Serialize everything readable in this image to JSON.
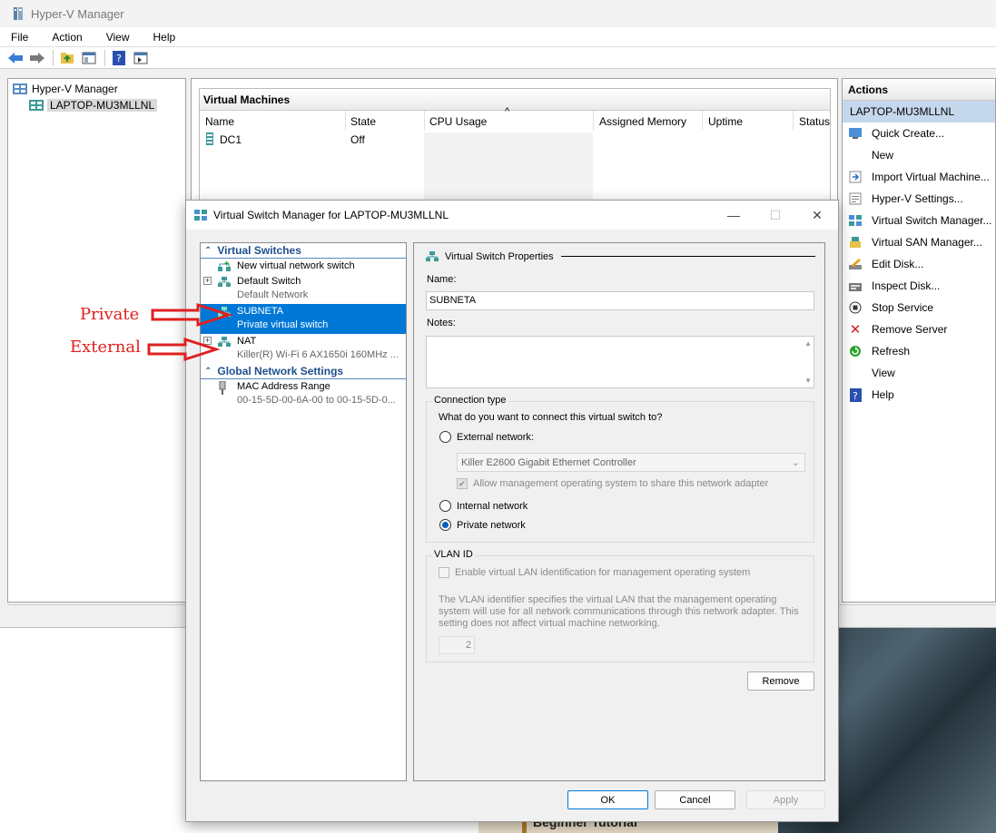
{
  "app": {
    "title": "Hyper-V Manager",
    "menu": [
      "File",
      "Action",
      "View",
      "Help"
    ]
  },
  "tree": {
    "root": "Hyper-V Manager",
    "host": "LAPTOP-MU3MLLNL"
  },
  "vm_panel": {
    "title": "Virtual Machines",
    "columns": [
      "Name",
      "State",
      "CPU Usage",
      "Assigned Memory",
      "Uptime",
      "Status"
    ],
    "rows": [
      {
        "name": "DC1",
        "state": "Off"
      }
    ]
  },
  "actions": {
    "title": "Actions",
    "host": "LAPTOP-MU3MLLNL",
    "items": [
      {
        "label": "Quick Create...",
        "icon": "quick-create-icon"
      },
      {
        "label": "New",
        "icon": "none"
      },
      {
        "label": "Import Virtual Machine...",
        "icon": "import-icon"
      },
      {
        "label": "Hyper-V Settings...",
        "icon": "settings-icon"
      },
      {
        "label": "Virtual Switch Manager...",
        "icon": "switch-icon"
      },
      {
        "label": "Virtual SAN Manager...",
        "icon": "san-icon"
      },
      {
        "label": "Edit Disk...",
        "icon": "edit-disk-icon"
      },
      {
        "label": "Inspect Disk...",
        "icon": "inspect-disk-icon"
      },
      {
        "label": "Stop Service",
        "icon": "stop-icon"
      },
      {
        "label": "Remove Server",
        "icon": "remove-icon"
      },
      {
        "label": "Refresh",
        "icon": "refresh-icon"
      },
      {
        "label": "View",
        "icon": "none"
      },
      {
        "label": "Help",
        "icon": "help-icon"
      }
    ]
  },
  "dialog": {
    "title": "Virtual Switch Manager for LAPTOP-MU3MLLNL",
    "section_switches": "Virtual Switches",
    "new_switch": "New virtual network switch",
    "switches": [
      {
        "name": "Default Switch",
        "desc": "Default Network"
      },
      {
        "name": "SUBNETA",
        "desc": "Private virtual switch"
      },
      {
        "name": "NAT",
        "desc": "Killer(R) Wi-Fi 6 AX1650i 160MHz ..."
      }
    ],
    "section_global": "Global Network Settings",
    "mac": {
      "name": "MAC Address Range",
      "desc": "00-15-5D-00-6A-00 to 00-15-5D-0..."
    },
    "props_title": "Virtual Switch Properties",
    "name_label": "Name:",
    "name_value": "SUBNETA",
    "notes_label": "Notes:",
    "conn_title": "Connection type",
    "conn_question": "What do you want to connect this virtual switch to?",
    "external_label": "External network:",
    "adapter": "Killer E2600 Gigabit Ethernet Controller",
    "allow_mgmt": "Allow management operating system to share this network adapter",
    "internal_label": "Internal network",
    "private_label": "Private network",
    "vlan_title": "VLAN ID",
    "vlan_enable": "Enable virtual LAN identification for management operating system",
    "vlan_desc": "The VLAN identifier specifies the virtual LAN that the management operating system will use for all network communications through this network adapter. This setting does not affect virtual machine networking.",
    "vlan_value": "2",
    "remove": "Remove",
    "ok": "OK",
    "cancel": "Cancel",
    "apply": "Apply"
  },
  "annotations": {
    "private": "Private",
    "external": "External"
  },
  "background": {
    "tutorial_text": "Beginner Tutorial"
  },
  "colors": {
    "selection": "#0078d7",
    "annotation": "#e02020",
    "actions_header": "#c5d7ec"
  }
}
